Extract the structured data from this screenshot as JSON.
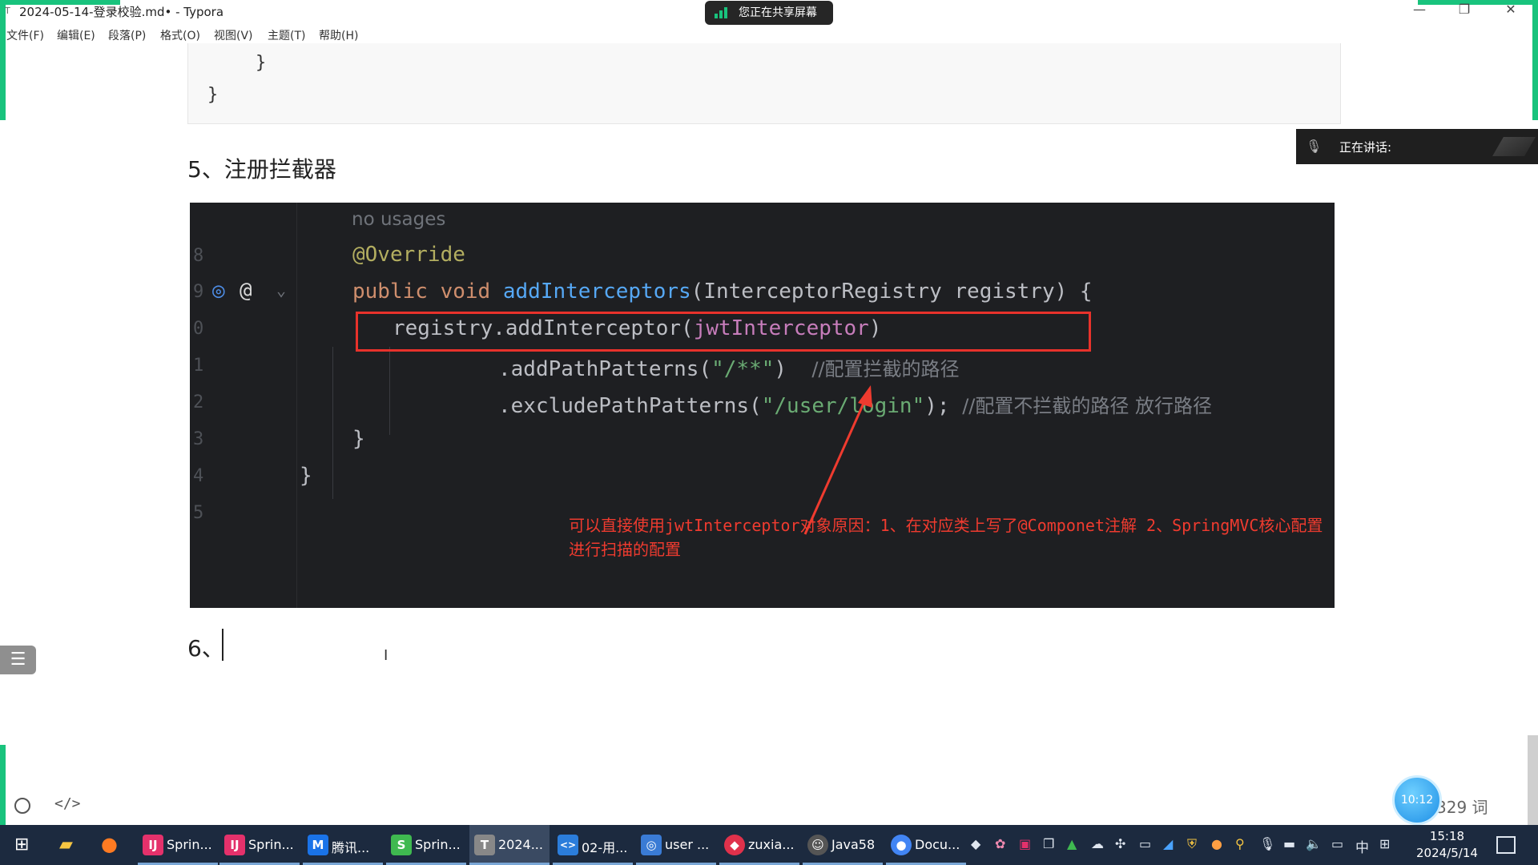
{
  "window": {
    "title": "2024-05-14-登录校验.md• - Typora",
    "minimize": "—",
    "restore": "❐",
    "close": "✕"
  },
  "share": {
    "label": "您正在共享屏幕"
  },
  "menu": [
    "文件(F)",
    "编辑(E)",
    "段落(P)",
    "格式(O)",
    "视图(V)",
    "主题(T)",
    "帮助(H)"
  ],
  "top_code": {
    "line1": "}",
    "line2": "}"
  },
  "speaking": {
    "label": "正在讲话:"
  },
  "doc": {
    "heading5": "5、注册拦截器",
    "heading6": "6、"
  },
  "code": {
    "line_numbers": [
      "8",
      "9",
      "0",
      "1",
      "2",
      "3",
      "4",
      "5"
    ],
    "hint": "no usages",
    "annotation": "@Override",
    "kw_public": "public",
    "kw_void": "void",
    "method": "addInterceptors",
    "params": "(InterceptorRegistry registry) {",
    "reg_call": "registry.addInterceptor(",
    "reg_arg": "jwtInterceptor",
    "reg_close": ")",
    "add_path": ".addPathPatterns(",
    "add_path_str": "\"/**\"",
    "add_path_close": ")",
    "add_path_comment": "//配置拦截的路径",
    "exclude_path": ".excludePathPatterns(",
    "exclude_path_str": "\"/user/login\"",
    "exclude_path_close": ");",
    "exclude_path_comment": "//配置不拦截的路径 放行路径",
    "close_inner": "}",
    "close_outer": "}",
    "note": "可以直接使用jwtInterceptor对象原因：1、在对应类上写了@Componet注解 2、SpringMVC核心配置进行扫描的配置"
  },
  "statusbar": {
    "word_count": "329 词",
    "clock_badge": "10:12"
  },
  "taskbar": {
    "items": [
      {
        "label": "Sprin...",
        "icon": "IJ",
        "color": "#e4316b"
      },
      {
        "label": "Sprin...",
        "icon": "IJ",
        "color": "#e4316b"
      },
      {
        "label": "腾讯...",
        "icon": "M",
        "color": "#1a73e8"
      },
      {
        "label": "Sprin...",
        "icon": "S",
        "color": "#3fb950"
      },
      {
        "label": "2024...",
        "icon": "T",
        "color": "#888888"
      },
      {
        "label": "02-用...",
        "icon": "<>",
        "color": "#2b7ddb"
      },
      {
        "label": "user ...",
        "icon": "◎",
        "color": "#3a7bd5"
      },
      {
        "label": "zuxia...",
        "icon": "◆",
        "color": "#e0314b"
      },
      {
        "label": "Java58",
        "icon": "☺",
        "color": "#555555"
      },
      {
        "label": "Docu...",
        "icon": "●",
        "color": "#4285f4"
      }
    ],
    "ime": "中",
    "time": "15:18",
    "date": "2024/5/14"
  }
}
